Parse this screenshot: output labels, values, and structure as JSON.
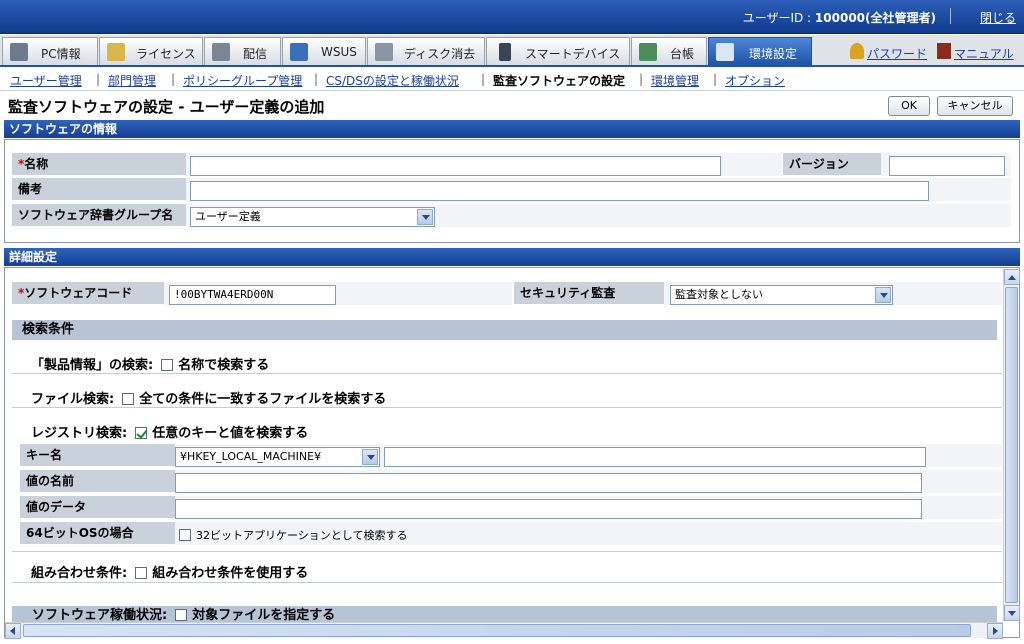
{
  "header": {
    "user_label": "ユーザーID : ",
    "user_value": "100000(全社管理者)",
    "logout": "閉じる"
  },
  "tabs": [
    {
      "label": "PC情報",
      "icon": "pc-icon"
    },
    {
      "label": "ライセンス",
      "icon": "license-icon"
    },
    {
      "label": "配信",
      "icon": "distribution-icon"
    },
    {
      "label": "WSUS",
      "icon": "wsus-icon"
    },
    {
      "label": "ディスク消去",
      "icon": "disk-erase-icon"
    },
    {
      "label": "スマートデバイス",
      "icon": "smart-device-icon"
    },
    {
      "label": "台帳",
      "icon": "ledger-icon"
    },
    {
      "label": "環境設定",
      "icon": "settings-icon",
      "active": true
    }
  ],
  "right_links": {
    "password": "パスワード",
    "manual": "マニュアル"
  },
  "subnav": [
    "ユーザー管理",
    "部門管理",
    "ポリシーグループ管理",
    "CS/DSの設定と稼働状況",
    "監査ソフトウェアの設定",
    "環境管理",
    "オプション"
  ],
  "page": {
    "title": "監査ソフトウェアの設定 - ユーザー定義の追加",
    "ok": "OK",
    "cancel": "キャンセル"
  },
  "software_info": {
    "header": "ソフトウェアの情報",
    "name_label": "名称",
    "required_mark": "*",
    "name_value": "",
    "version_label": "バージョン",
    "version_value": "",
    "remarks_label": "備考",
    "remarks_value": "",
    "dict_group_label": "ソフトウェア辞書グループ名",
    "dict_group_value": "ユーザー定義"
  },
  "details": {
    "header": "詳細設定",
    "code_label": "ソフトウェアコード",
    "code_value": "!00BYTWA4ERD00N",
    "security_label": "セキュリティ監査",
    "security_value": "監査対象としない",
    "search_header": "検索条件",
    "product_search_label": "「製品情報」の検索:",
    "product_search_option": "名称で検索する",
    "file_search_label": "ファイル検索:",
    "file_search_option": "全ての条件に一致するファイルを検索する",
    "registry_search_label": "レジストリ検索:",
    "registry_search_option": "任意のキーと値を検索する",
    "key_label": "キー名",
    "key_root": "¥HKEY_LOCAL_MACHINE¥",
    "key_value": "",
    "value_name_label": "値の名前",
    "value_name": "",
    "value_data_label": "値のデータ",
    "value_data": "",
    "os64_label": "64ビットOSの場合",
    "os64_option": "32ビットアプリケーションとして検索する",
    "combo_label": "組み合わせ条件:",
    "combo_option": "組み合わせ条件を使用する",
    "usage_label": "ソフトウェア稼働状況:",
    "usage_option": "対象ファイルを指定する"
  },
  "states": {
    "product_search": false,
    "file_search": false,
    "registry_search": true,
    "os64": false,
    "combo": false,
    "usage": false
  }
}
